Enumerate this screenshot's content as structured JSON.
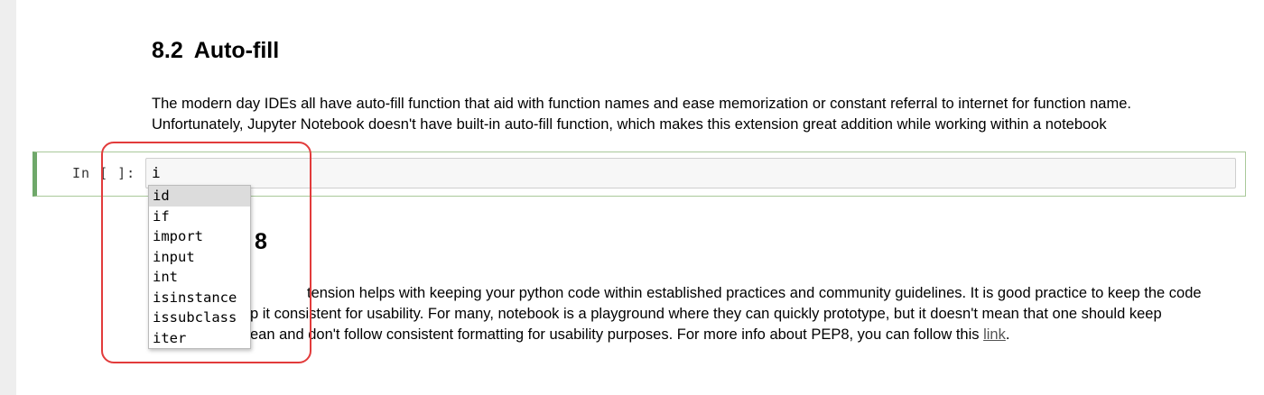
{
  "section1": {
    "number": "8.2",
    "title": "Auto-fill",
    "paragraph_lines": [
      "The modern day IDEs all have auto-fill function that aid with function names and ease memorization or constant referral to internet for function name.",
      "Unfortunately, Jupyter Notebook doesn't have built-in auto-fill function, which makes this extension great addition while working within a notebook"
    ]
  },
  "cell": {
    "prompt": "In [ ]:",
    "input_value": "i"
  },
  "autocomplete": {
    "selected_index": 0,
    "options": [
      "id",
      "if",
      "import",
      "input",
      "int",
      "isinstance",
      "issubclass",
      "iter"
    ]
  },
  "section2": {
    "title_visible": "8",
    "paragraph_lines": [
      "tension helps with keeping your python code within established practices and community guidelines. It is good practice to keep the code",
      "p it consistent for usability. For many, notebook is a playground where they can quickly prototype, but it doesn't mean that one should keep",
      "ean and don't follow consistent formatting for usability purposes. For more info about PEP8, you can follow this "
    ],
    "link_text": "link",
    "trailing": "."
  },
  "colors": {
    "highlight": "#e23b3b",
    "cell_border": "#6fa86a",
    "selected_option": "#dcdcdc"
  }
}
